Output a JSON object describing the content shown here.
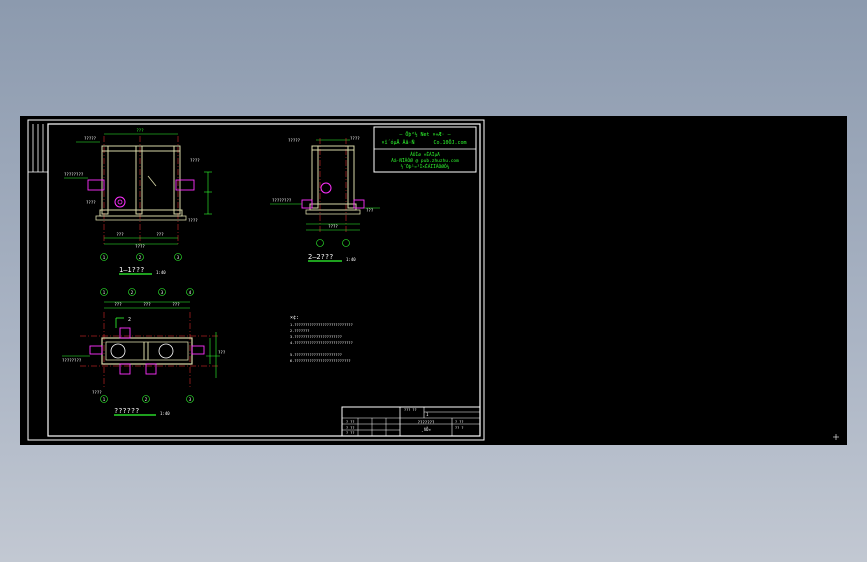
{
  "viewport": {
    "background": "#000000"
  },
  "colors": {
    "frame": "#ffffff",
    "wall": "#d8d8a8",
    "axis": "#ff3030",
    "dim": "#30ff30",
    "pipe": "#ff30ff",
    "text_green": "#30ff30",
    "text_white": "#ffffff",
    "text_yellow": "#ffff40",
    "text_cyan": "#40ffff"
  },
  "stamp": {
    "line1": "—  Öþ²½ Net ×÷Æ·  —",
    "line2a": "×î´óµÄ Ãâ·Ñ",
    "line2b": "Co.10ÖJ.com",
    "line3": "ÂÚÌø ×ÊÁÏµÄ",
    "line4": "Ãâ·ÑÏÂÔØ @ pub.zhuzhu.com",
    "line5": "½¨Öþ¹¤³Ì×ÊÁÏÏÂÔØÕ¾"
  },
  "section1": {
    "title": "1—1???",
    "scale": "1:40"
  },
  "section2": {
    "title": "2—2???",
    "scale": "1:40"
  },
  "plan": {
    "title": "??????",
    "scale": "1:40",
    "cut_label": "2"
  },
  "notes": {
    "header": "×¢:",
    "lines": [
      "1.???????????????????????????",
      "2.???????",
      "3.??????????????????????",
      "4.???????????????????????????",
      "5.??????????????????????",
      "6.??????????????????????????"
    ]
  },
  "title_block": {
    "project_name": "???????",
    "drawing_name": "¸ñÕ¤",
    "sheet": "1"
  },
  "axis_labels": {
    "section1": [
      "1",
      "2",
      "3"
    ],
    "plan_top": [
      "1",
      "2",
      "3",
      "4"
    ],
    "plan_bottom": [
      "1",
      "2",
      "3"
    ]
  }
}
